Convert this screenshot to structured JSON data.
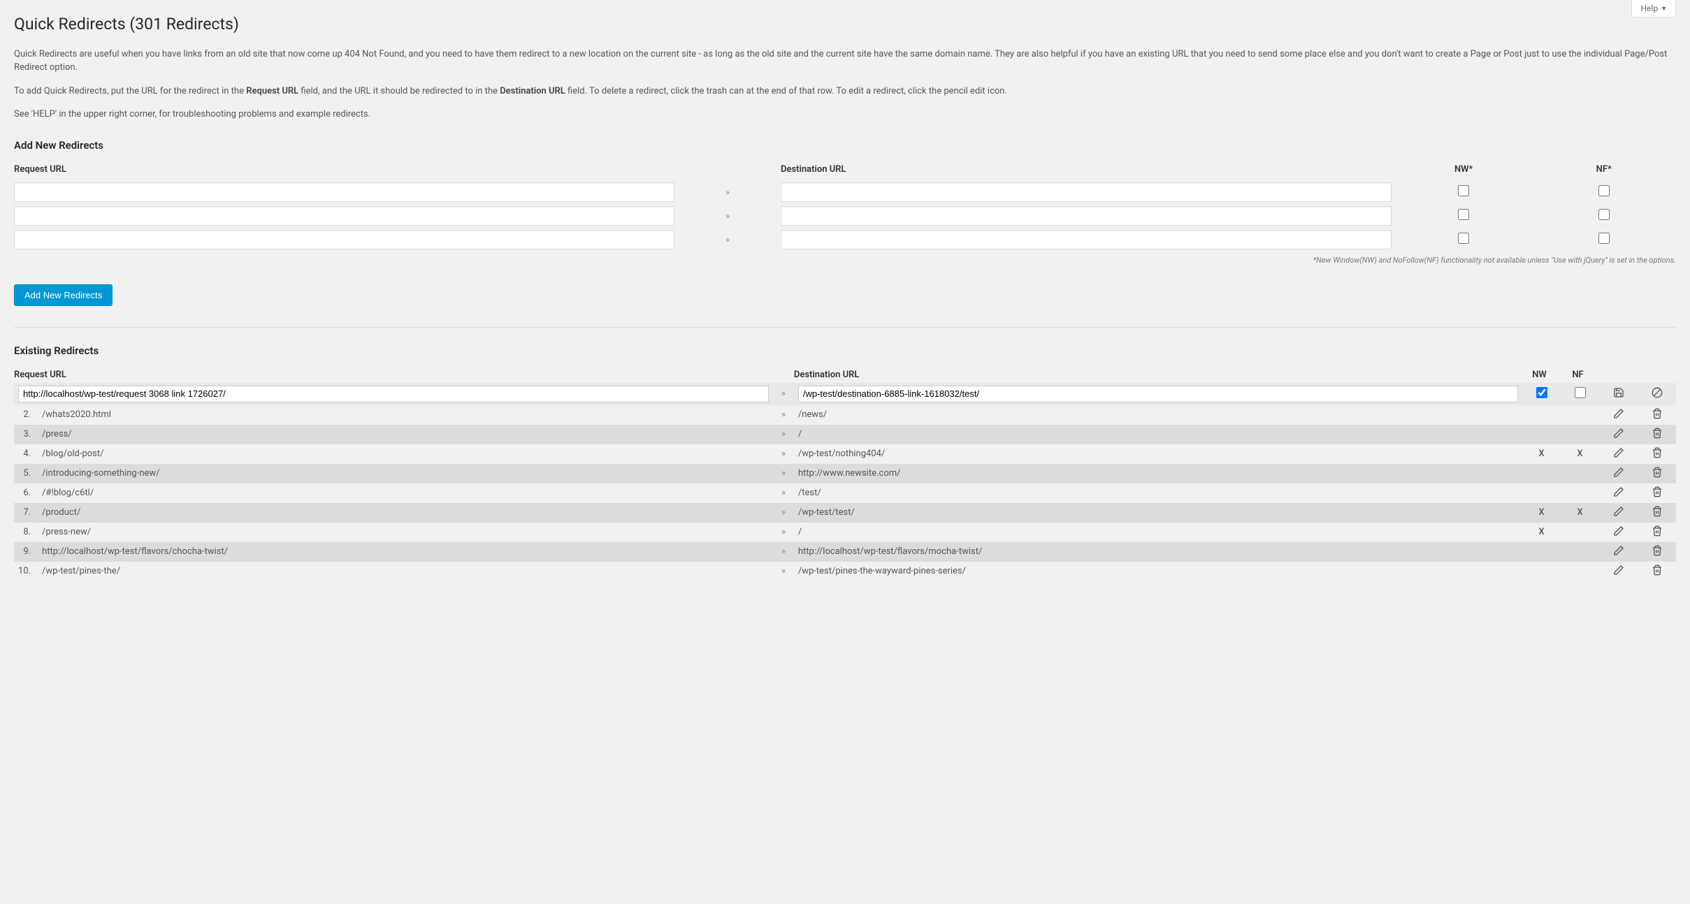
{
  "help": {
    "label": "Help"
  },
  "page": {
    "title": "Quick Redirects (301 Redirects)",
    "intro1_a": "Quick Redirects are useful when you have links from an old site that now come up 404 Not Found, and you need to have them redirect to a new location on the current site - as long as the old site and the current site have the same domain name. They are also helpful if you have an existing URL that you need to send some place else and you don't want to create a Page or Post just to use the individual Page/Post Redirect option.",
    "intro2_a": "To add Quick Redirects, put the URL for the redirect in the ",
    "intro2_b": "Request URL",
    "intro2_c": " field, and the URL it should be redirected to in the ",
    "intro2_d": "Destination URL",
    "intro2_e": " field. To delete a redirect, click the trash can at the end of that row. To edit a redirect, click the pencil edit icon.",
    "intro3": "See 'HELP' in the upper right corner, for troubleshooting problems and example redirects."
  },
  "add": {
    "heading": "Add New Redirects",
    "col_request": "Request URL",
    "col_destination": "Destination URL",
    "col_nw": "NW*",
    "col_nf": "NF*",
    "arrow": "»",
    "note": "*New Window(NW) and NoFollow(NF) functionality not available unless \"Use with jQuery\" is set in the options.",
    "button": "Add New Redirects",
    "rows": [
      {
        "request": "",
        "destination": "",
        "nw": false,
        "nf": false
      },
      {
        "request": "",
        "destination": "",
        "nw": false,
        "nf": false
      },
      {
        "request": "",
        "destination": "",
        "nw": false,
        "nf": false
      }
    ]
  },
  "existing": {
    "heading": "Existing Redirects",
    "col_request": "Request URL",
    "col_destination": "Destination URL",
    "col_nw": "NW",
    "col_nf": "NF",
    "arrow": "»",
    "edit_row": {
      "request": "http://localhost/wp-test/request 3068 link 1726027/",
      "destination": "/wp-test/destination-6885-link-1618032/test/",
      "nw": true,
      "nf": false
    },
    "rows": [
      {
        "idx": "2.",
        "request": "/whats2020.html",
        "destination": "/news/",
        "nw": "",
        "nf": "",
        "alt": false
      },
      {
        "idx": "3.",
        "request": "/press/",
        "destination": "/",
        "nw": "",
        "nf": "",
        "alt": true
      },
      {
        "idx": "4.",
        "request": "/blog/old-post/",
        "destination": "/wp-test/nothing404/",
        "nw": "X",
        "nf": "X",
        "alt": false
      },
      {
        "idx": "5.",
        "request": "/introducing-something-new/",
        "destination": "http://www.newsite.com/",
        "nw": "",
        "nf": "",
        "alt": true
      },
      {
        "idx": "6.",
        "request": "/#!blog/c6tl/",
        "destination": "/test/",
        "nw": "",
        "nf": "",
        "alt": false
      },
      {
        "idx": "7.",
        "request": "/product/",
        "destination": "/wp-test/test/",
        "nw": "X",
        "nf": "X",
        "alt": true
      },
      {
        "idx": "8.",
        "request": "/press-new/",
        "destination": "/",
        "nw": "X",
        "nf": "",
        "alt": false
      },
      {
        "idx": "9.",
        "request": "http://localhost/wp-test/flavors/chocha-twist/",
        "destination": "http://localhost/wp-test/flavors/mocha-twist/",
        "nw": "",
        "nf": "",
        "alt": true
      },
      {
        "idx": "10.",
        "request": "/wp-test/pines-the/",
        "destination": "/wp-test/pines-the-wayward-pines-series/",
        "nw": "",
        "nf": "",
        "alt": false
      }
    ]
  }
}
